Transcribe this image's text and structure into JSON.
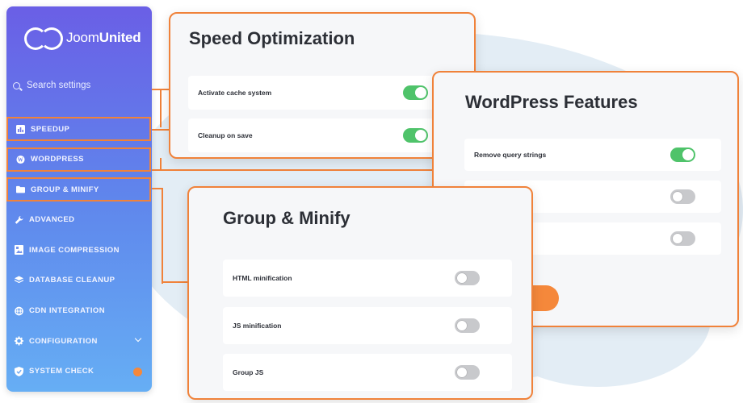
{
  "brand": {
    "name_light": "Joom",
    "name_bold": "United"
  },
  "search": {
    "placeholder": "Search settings"
  },
  "sidebar": {
    "items": [
      {
        "label": "SPEEDUP",
        "icon": "chart-icon"
      },
      {
        "label": "WORDPRESS",
        "icon": "wordpress-icon"
      },
      {
        "label": "GROUP & MINIFY",
        "icon": "folder-icon"
      },
      {
        "label": "ADVANCED",
        "icon": "wrench-icon"
      },
      {
        "label": "IMAGE COMPRESSION",
        "icon": "image-icon"
      },
      {
        "label": "DATABASE CLEANUP",
        "icon": "database-icon"
      },
      {
        "label": "CDN INTEGRATION",
        "icon": "globe-icon"
      },
      {
        "label": "CONFIGURATION",
        "icon": "gear-icon"
      },
      {
        "label": "SYSTEM CHECK",
        "icon": "shield-icon"
      }
    ]
  },
  "speed": {
    "title": "Speed Optimization",
    "rows": [
      {
        "label": "Activate cache system",
        "on": true
      },
      {
        "label": "Cleanup on save",
        "on": true
      }
    ]
  },
  "wordpress": {
    "title": "WordPress Features",
    "rows": [
      {
        "label": "Remove query strings",
        "on": true
      },
      {
        "label": "",
        "on": false
      },
      {
        "label": "",
        "on": false
      }
    ]
  },
  "group": {
    "title": "Group & Minify",
    "rows": [
      {
        "label": "HTML minification",
        "on": false
      },
      {
        "label": "JS minification",
        "on": false
      },
      {
        "label": "Group JS",
        "on": false
      }
    ]
  },
  "colors": {
    "accent": "#f0823a",
    "toggle_on": "#4fc36a",
    "toggle_off": "#c8c9cc"
  }
}
